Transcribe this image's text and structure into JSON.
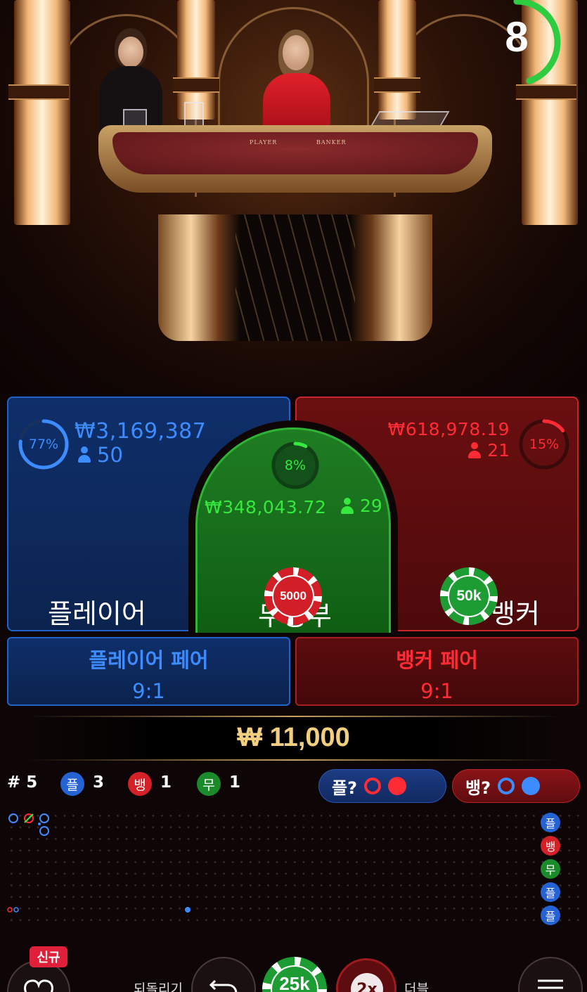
{
  "timer": {
    "seconds": "8",
    "fraction_remaining": 0.45,
    "color": "#2ecc40"
  },
  "studio": {
    "table_labels": {
      "player": "PLAYER",
      "banker": "BANKER"
    }
  },
  "bets": {
    "player": {
      "percent": "77%",
      "percent_value": 0.77,
      "amount": "₩3,169,387",
      "players": "50",
      "label": "플레이어",
      "color": "#3d8cff"
    },
    "tie": {
      "percent": "8%",
      "percent_value": 0.08,
      "amount": "₩348,043.72",
      "players": "29",
      "label": "무승부",
      "color": "#37e83f",
      "chip": "5000"
    },
    "banker": {
      "percent": "15%",
      "percent_value": 0.15,
      "amount": "₩618,978.19",
      "players": "21",
      "label": "뱅커",
      "color": "#ff2c35",
      "chip": "50k"
    },
    "player_pair": {
      "label": "플레이어 페어",
      "odds": "9:1"
    },
    "banker_pair": {
      "label": "뱅커 페어",
      "odds": "9:1"
    }
  },
  "total_bet": "₩ 11,000",
  "stats": {
    "round": "# 5",
    "player_badge": "플",
    "player_count": "3",
    "banker_badge": "뱅",
    "banker_count": "1",
    "tie_badge": "무",
    "tie_count": "1",
    "predict_player": "플?",
    "predict_banker": "뱅?"
  },
  "road_side": [
    "플",
    "뱅",
    "무",
    "플",
    "플"
  ],
  "controls": {
    "new_badge": "신규",
    "undo_label": "되돌리기",
    "chip": "25k",
    "double_chip": "2x",
    "double_label": "더블"
  }
}
